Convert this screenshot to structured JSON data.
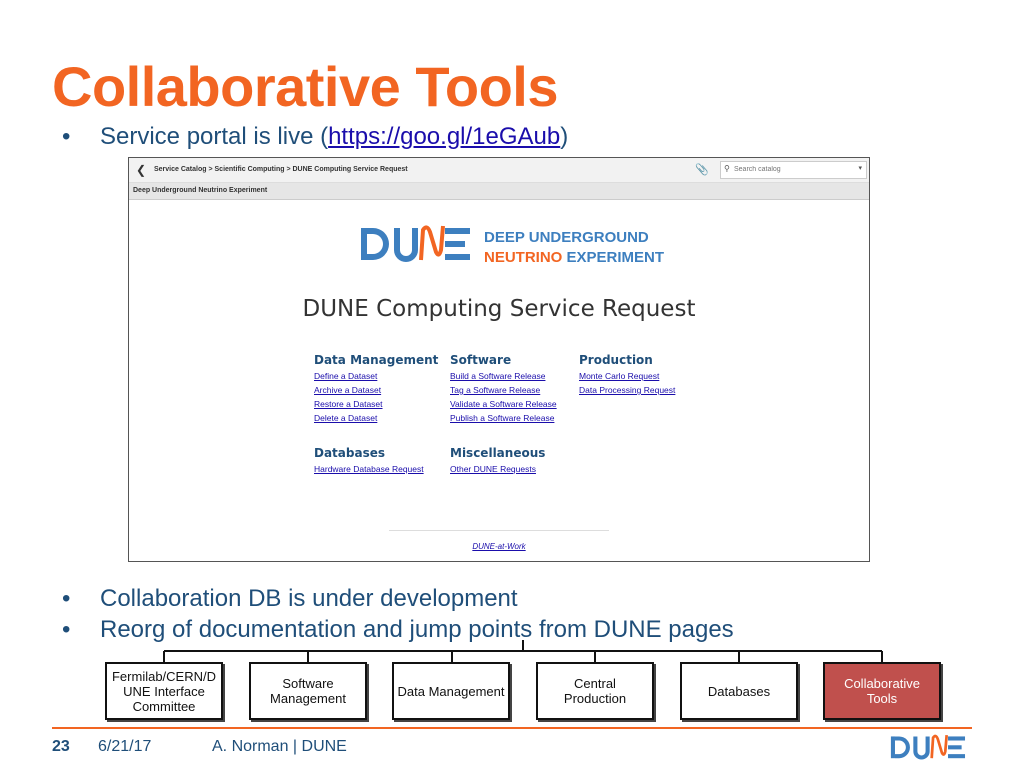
{
  "slide": {
    "title": "Collaborative Tools",
    "bullets": [
      {
        "text_before": "Service portal is live (",
        "link": "https://goo.gl/1eGAub",
        "text_after": ")"
      },
      {
        "text": "Collaboration DB is under development"
      },
      {
        "text": "Reorg of documentation and jump points from DUNE pages"
      }
    ],
    "bullet_glyph": "•"
  },
  "portal": {
    "breadcrumb": "Service Catalog > Scientific Computing > DUNE Computing Service Request",
    "search_placeholder": "Search catalog",
    "subheader": "Deep Underground Neutrino Experiment",
    "logo": {
      "wordmark": "DUNE",
      "line1": "DEEP UNDERGROUND",
      "line2_a": "NEUTRINO",
      "line2_b": "EXPERIMENT"
    },
    "title": "DUNE Computing Service Request",
    "sections": [
      {
        "heading": "Data Management",
        "links": [
          "Define a Dataset",
          "Archive a Dataset",
          "Restore a Dataset",
          "Delete a Dataset"
        ]
      },
      {
        "heading": "Software",
        "links": [
          "Build a Software Release",
          "Tag a Software Release",
          "Validate a Software Release",
          "Publish a Software Release"
        ]
      },
      {
        "heading": "Production",
        "links": [
          "Monte Carlo Request",
          "Data Processing Request"
        ]
      },
      {
        "heading": "Databases",
        "links": [
          "Hardware Database Request"
        ]
      },
      {
        "heading": "Miscellaneous",
        "links": [
          "Other DUNE Requests"
        ]
      }
    ],
    "footer_link": "DUNE-at-Work"
  },
  "org_chart": {
    "boxes": [
      {
        "label": "Fermilab/CERN/DUNE Interface Committee",
        "line1": "Fermilab/CERN/D",
        "line2": "UNE Interface",
        "line3": "Committee"
      },
      {
        "label": "Software Management",
        "line1": "Software",
        "line2": "Management",
        "line3": ""
      },
      {
        "label": "Data Management",
        "line1": "Data Management",
        "line2": "",
        "line3": ""
      },
      {
        "label": "Central Production",
        "line1": "Central",
        "line2": "Production",
        "line3": ""
      },
      {
        "label": "Databases",
        "line1": "Databases",
        "line2": "",
        "line3": ""
      },
      {
        "label": "Collaborative Tools",
        "line1": "Collaborative",
        "line2": "Tools",
        "line3": ""
      }
    ],
    "highlight_color": "#c0504d"
  },
  "footer": {
    "page_number": "23",
    "date": "6/21/17",
    "author": "A. Norman | DUNE",
    "logo_word": "DUNE"
  },
  "colors": {
    "title": "#f26522",
    "text": "#1f4e79",
    "link": "#1a0dab",
    "accent": "#f26522"
  }
}
